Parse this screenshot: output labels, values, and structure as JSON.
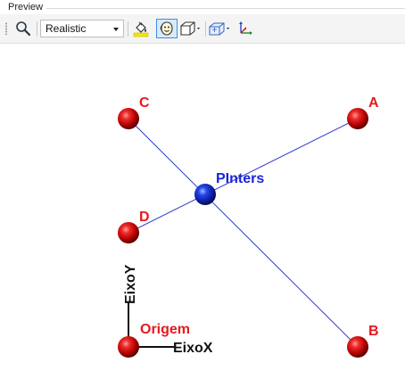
{
  "panel": {
    "title": "Preview"
  },
  "toolbar": {
    "render_mode": {
      "selected": "Realistic"
    },
    "buttons": [
      {
        "name": "zoom-button",
        "icon": "magnifier-icon"
      },
      {
        "name": "fill-color-button",
        "icon": "paint-bucket-icon"
      },
      {
        "name": "face-view-button",
        "icon": "face-icon",
        "active": true
      },
      {
        "name": "box-view-button",
        "icon": "box-icon",
        "has_dropdown": true
      },
      {
        "name": "view-cube-button",
        "icon": "view-cube-icon",
        "has_dropdown": true
      },
      {
        "name": "axes-button",
        "icon": "axes-icon"
      }
    ]
  },
  "scene": {
    "colors": {
      "point": "#d41414",
      "center_point": "#1a2fd6",
      "connector_line": "#2b3ad0",
      "red_label": "#e8191d",
      "blue_label": "#1a25d6",
      "axis": "#111111"
    },
    "labels": {
      "a": "A",
      "b": "B",
      "c": "C",
      "d": "D",
      "center": "PInters",
      "origin": "Origem",
      "x_axis": "EixoX",
      "y_axis": "EixoY"
    }
  }
}
